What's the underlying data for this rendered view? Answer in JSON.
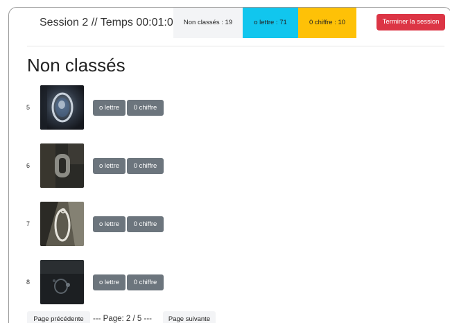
{
  "header": {
    "session_title": "Session 2 // Temps 00:01:00",
    "counts": {
      "unclassified": "Non classés : 19",
      "o_letter": "o lettre : 71",
      "zero_digit": "0 chiffre : 10"
    },
    "end_session_label": "Terminer la session",
    "colors": {
      "o_letter": "#11c6ee",
      "zero_digit": "#fec107",
      "end_session": "#dc3545",
      "classify_button": "#6c757d"
    }
  },
  "main": {
    "title": "Non classés",
    "rows": [
      {
        "index": "5",
        "o_label": "o lettre",
        "zero_label": "0 chiffre"
      },
      {
        "index": "6",
        "o_label": "o lettre",
        "zero_label": "0 chiffre"
      },
      {
        "index": "7",
        "o_label": "o lettre",
        "zero_label": "0 chiffre"
      },
      {
        "index": "8",
        "o_label": "o lettre",
        "zero_label": "0 chiffre"
      }
    ]
  },
  "pagination": {
    "prev_label": "Page précédente",
    "page_info": "--- Page: 2 / 5 ---",
    "next_label": "Page suivante"
  }
}
